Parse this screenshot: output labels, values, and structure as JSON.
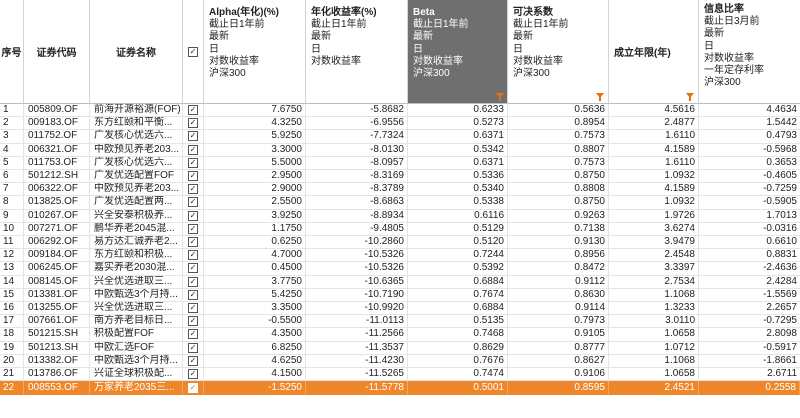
{
  "headers": {
    "idx": "序号",
    "code": "证券代码",
    "name": "证券名称",
    "select_mark": "✓",
    "alpha": {
      "title": "Alpha(年化)(%)",
      "lines": [
        "截止日1年前",
        "最新",
        "日",
        "对数收益率",
        "沪深300"
      ]
    },
    "annual_return": {
      "title": "年化收益率(%)",
      "lines": [
        "截止日1年前",
        "最新",
        "日",
        "对数收益率"
      ]
    },
    "beta": {
      "title": "Beta",
      "lines": [
        "截止日1年前",
        "最新",
        "日",
        "对数收益率",
        "沪深300"
      ]
    },
    "r_squared": {
      "title": "可决系数",
      "lines": [
        "截止日1年前",
        "最新",
        "日",
        "对数收益率",
        "沪深300"
      ]
    },
    "founded_years": "成立年限(年)",
    "info_ratio": {
      "title": "信息比率",
      "lines": [
        "截止日3月前",
        "最新",
        "日",
        "对数收益率",
        "一年定存利率",
        "沪深300"
      ]
    }
  },
  "rows": [
    {
      "idx": "1",
      "code": "005809.OF",
      "name": "前海开源裕源(FOF)",
      "checked": "✓",
      "alpha": "7.6750",
      "ret": "-5.8682",
      "beta": "0.6233",
      "r2": "0.5636",
      "age": "4.5616",
      "ir": "4.4634"
    },
    {
      "idx": "2",
      "code": "009183.OF",
      "name": "东方红颐和平衡...",
      "checked": "✓",
      "alpha": "4.3250",
      "ret": "-6.9556",
      "beta": "0.5273",
      "r2": "0.8954",
      "age": "2.4877",
      "ir": "1.5442"
    },
    {
      "idx": "3",
      "code": "011752.OF",
      "name": "广发核心优选六...",
      "checked": "✓",
      "alpha": "5.9250",
      "ret": "-7.7324",
      "beta": "0.6371",
      "r2": "0.7573",
      "age": "1.6110",
      "ir": "0.4793"
    },
    {
      "idx": "4",
      "code": "006321.OF",
      "name": "中欧预见养老203...",
      "checked": "✓",
      "alpha": "3.3000",
      "ret": "-8.0130",
      "beta": "0.5342",
      "r2": "0.8807",
      "age": "4.1589",
      "ir": "-0.5968"
    },
    {
      "idx": "5",
      "code": "011753.OF",
      "name": "广发核心优选六...",
      "checked": "✓",
      "alpha": "5.5000",
      "ret": "-8.0957",
      "beta": "0.6371",
      "r2": "0.7573",
      "age": "1.6110",
      "ir": "0.3653"
    },
    {
      "idx": "6",
      "code": "501212.SH",
      "name": "广发优选配置FOF",
      "checked": "✓",
      "alpha": "2.9500",
      "ret": "-8.3169",
      "beta": "0.5336",
      "r2": "0.8750",
      "age": "1.0932",
      "ir": "-0.4605"
    },
    {
      "idx": "7",
      "code": "006322.OF",
      "name": "中欧预见养老203...",
      "checked": "✓",
      "alpha": "2.9000",
      "ret": "-8.3789",
      "beta": "0.5340",
      "r2": "0.8808",
      "age": "4.1589",
      "ir": "-0.7259"
    },
    {
      "idx": "8",
      "code": "013825.OF",
      "name": "广发优选配置两...",
      "checked": "✓",
      "alpha": "2.5500",
      "ret": "-8.6863",
      "beta": "0.5338",
      "r2": "0.8750",
      "age": "1.0932",
      "ir": "-0.5905"
    },
    {
      "idx": "9",
      "code": "010267.OF",
      "name": "兴全安泰积极养...",
      "checked": "✓",
      "alpha": "3.9250",
      "ret": "-8.8934",
      "beta": "0.6116",
      "r2": "0.9263",
      "age": "1.9726",
      "ir": "1.7013"
    },
    {
      "idx": "10",
      "code": "007271.OF",
      "name": "鹏华养老2045混...",
      "checked": "✓",
      "alpha": "1.1750",
      "ret": "-9.4805",
      "beta": "0.5129",
      "r2": "0.7138",
      "age": "3.6274",
      "ir": "-0.0316"
    },
    {
      "idx": "11",
      "code": "006292.OF",
      "name": "易方达汇诚养老2...",
      "checked": "✓",
      "alpha": "0.6250",
      "ret": "-10.2860",
      "beta": "0.5120",
      "r2": "0.9130",
      "age": "3.9479",
      "ir": "0.6610"
    },
    {
      "idx": "12",
      "code": "009184.OF",
      "name": "东方红颐和积极...",
      "checked": "✓",
      "alpha": "4.7000",
      "ret": "-10.5326",
      "beta": "0.7244",
      "r2": "0.8956",
      "age": "2.4548",
      "ir": "0.8831"
    },
    {
      "idx": "13",
      "code": "006245.OF",
      "name": "嘉实养老2030混...",
      "checked": "✓",
      "alpha": "0.4500",
      "ret": "-10.5326",
      "beta": "0.5392",
      "r2": "0.8472",
      "age": "3.3397",
      "ir": "-2.4636"
    },
    {
      "idx": "14",
      "code": "008145.OF",
      "name": "兴全优选进取三...",
      "checked": "✓",
      "alpha": "3.7750",
      "ret": "-10.6365",
      "beta": "0.6884",
      "r2": "0.9112",
      "age": "2.7534",
      "ir": "2.4284"
    },
    {
      "idx": "15",
      "code": "013381.OF",
      "name": "中欧甄选3个月持...",
      "checked": "✓",
      "alpha": "5.4250",
      "ret": "-10.7190",
      "beta": "0.7674",
      "r2": "0.8630",
      "age": "1.1068",
      "ir": "-1.5569"
    },
    {
      "idx": "16",
      "code": "013255.OF",
      "name": "兴全优选进取三...",
      "checked": "✓",
      "alpha": "3.3500",
      "ret": "-10.9920",
      "beta": "0.6884",
      "r2": "0.9114",
      "age": "1.3233",
      "ir": "2.2657"
    },
    {
      "idx": "17",
      "code": "007661.OF",
      "name": "南方养老目标日...",
      "checked": "✓",
      "alpha": "-0.5500",
      "ret": "-11.0113",
      "beta": "0.5135",
      "r2": "0.7973",
      "age": "3.0110",
      "ir": "-0.7295"
    },
    {
      "idx": "18",
      "code": "501215.SH",
      "name": "积极配置FOF",
      "checked": "✓",
      "alpha": "4.3500",
      "ret": "-11.2566",
      "beta": "0.7468",
      "r2": "0.9105",
      "age": "1.0658",
      "ir": "2.8098"
    },
    {
      "idx": "19",
      "code": "501213.SH",
      "name": "中欧汇选FOF",
      "checked": "✓",
      "alpha": "6.8250",
      "ret": "-11.3537",
      "beta": "0.8629",
      "r2": "0.8777",
      "age": "1.0712",
      "ir": "-0.5917"
    },
    {
      "idx": "20",
      "code": "013382.OF",
      "name": "中欧甄选3个月持...",
      "checked": "✓",
      "alpha": "4.6250",
      "ret": "-11.4230",
      "beta": "0.7676",
      "r2": "0.8627",
      "age": "1.1068",
      "ir": "-1.8661"
    },
    {
      "idx": "21",
      "code": "013786.OF",
      "name": "兴证全球积极配...",
      "checked": "✓",
      "alpha": "4.1500",
      "ret": "-11.5265",
      "beta": "0.7474",
      "r2": "0.9106",
      "age": "1.0658",
      "ir": "2.6711"
    },
    {
      "idx": "22",
      "code": "008553.OF",
      "name": "万家养老2035三...",
      "checked": "✓",
      "alpha": "-1.5250",
      "ret": "-11.5778",
      "beta": "0.5001",
      "r2": "0.8595",
      "age": "2.4521",
      "ir": "0.2558"
    }
  ],
  "highlighted_row_index": 21,
  "colors": {
    "beta_header_bg": "#6f6f6f",
    "highlight_row": "#f0862a",
    "filter_icon": "#e8710a"
  },
  "icons": {
    "filter": "filter-icon",
    "checkbox": "checkbox-icon"
  }
}
